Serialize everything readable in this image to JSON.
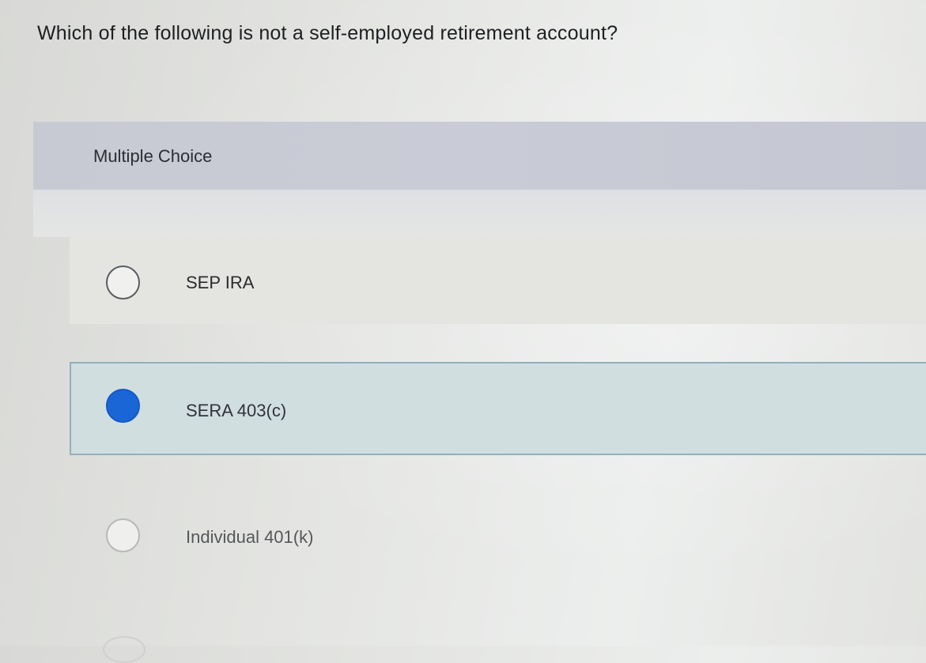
{
  "question": {
    "text": "Which of the following is not a self-employed retirement account?"
  },
  "section": {
    "label": "Multiple Choice"
  },
  "options": [
    {
      "label": "SEP IRA",
      "selected": false
    },
    {
      "label": "SERA 403(c)",
      "selected": true
    },
    {
      "label": "Individual 401(k)",
      "selected": false
    }
  ],
  "colors": {
    "selected_radio": "#1a66d6",
    "selected_background": "#d1dee0",
    "header_band": "#c8cad3"
  }
}
